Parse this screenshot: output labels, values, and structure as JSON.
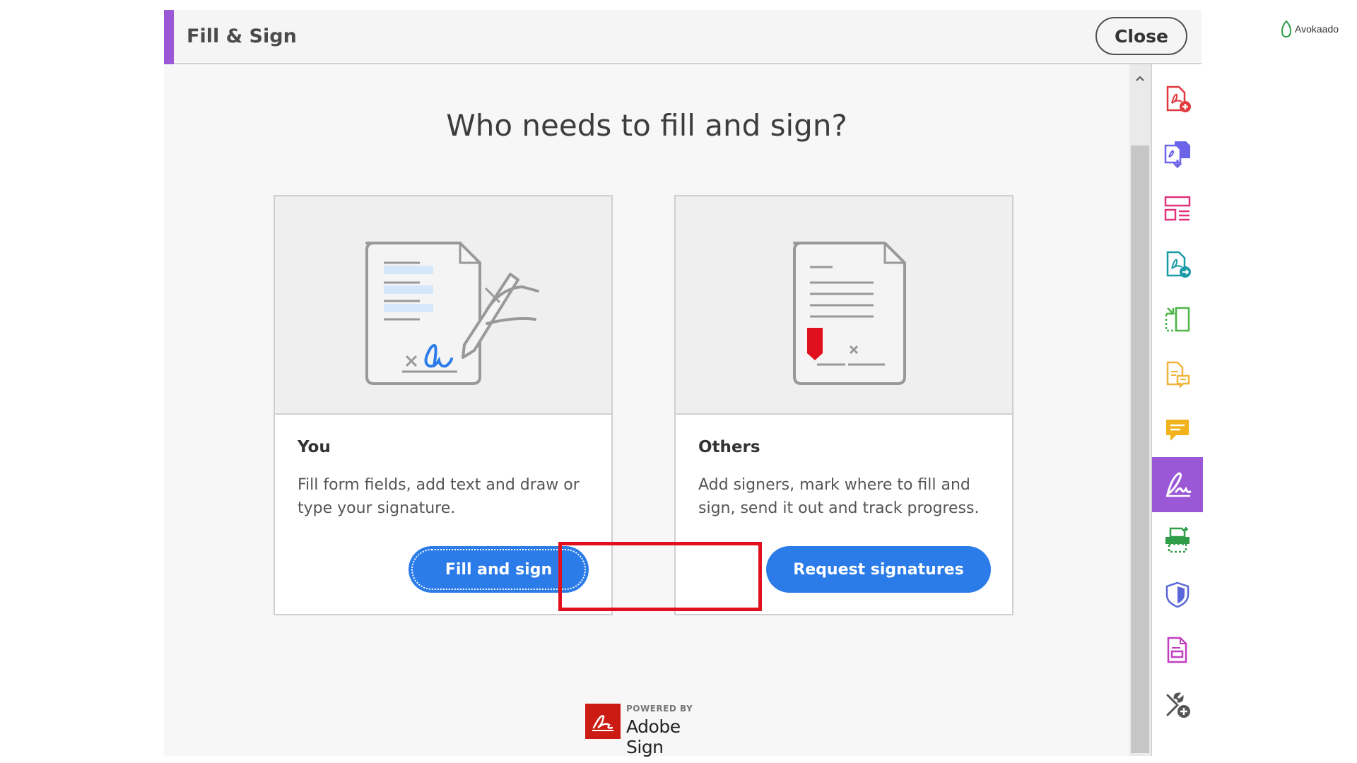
{
  "header": {
    "title": "Fill & Sign",
    "close_label": "Close"
  },
  "main": {
    "heading": "Who needs to fill and sign?",
    "cards": [
      {
        "title": "You",
        "description": "Fill form fields, add text and draw or type your signature.",
        "button_label": "Fill and sign",
        "icon": "document-signature-icon"
      },
      {
        "title": "Others",
        "description": "Add signers, mark where to fill and sign, send it out and track progress.",
        "button_label": "Request signatures",
        "icon": "document-request-icon"
      }
    ]
  },
  "footer": {
    "powered_by": "POWERED BY",
    "product": "Adobe Sign"
  },
  "branding": {
    "name": "Avokaado"
  },
  "tools_rail": [
    {
      "icon": "create-pdf-icon",
      "color": "#e0393e"
    },
    {
      "icon": "combine-files-icon",
      "color": "#6b63e8"
    },
    {
      "icon": "organize-pages-icon",
      "color": "#e0337a"
    },
    {
      "icon": "export-pdf-icon",
      "color": "#1b9aa8"
    },
    {
      "icon": "edit-pdf-icon",
      "color": "#4fb448"
    },
    {
      "icon": "prepare-form-icon",
      "color": "#f0b43c"
    },
    {
      "icon": "comment-icon",
      "color": "#f2b21c"
    },
    {
      "icon": "fill-sign-icon",
      "color": "#ffffff",
      "active": true
    },
    {
      "icon": "scan-icon",
      "color": "#2f9d47"
    },
    {
      "icon": "protect-icon",
      "color": "#5a67d8"
    },
    {
      "icon": "compress-pdf-icon",
      "color": "#c23ec1"
    },
    {
      "icon": "more-tools-icon",
      "color": "#555555"
    }
  ],
  "colors": {
    "accent": "#9a58d6",
    "primary_button": "#2b7ce9",
    "highlight": "#e0101e"
  }
}
